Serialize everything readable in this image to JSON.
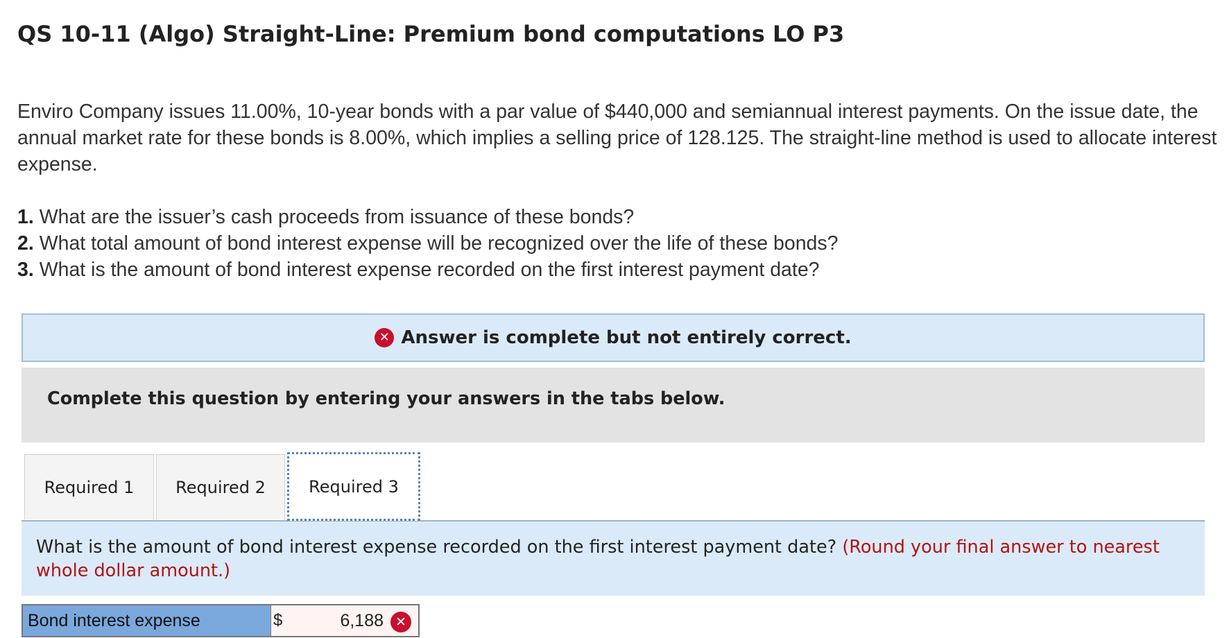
{
  "title": "QS 10-11 (Algo) Straight-Line: Premium bond computations LO P3",
  "problem_text": "Enviro Company issues 11.00%, 10-year bonds with a par value of $440,000 and semiannual interest payments. On the issue date, the annual market rate for these bonds is 8.00%, which implies a selling price of 128.125. The straight-line method is used to allocate interest expense.",
  "questions": [
    {
      "num": "1.",
      "text": "What are the issuer’s cash proceeds from issuance of these bonds?"
    },
    {
      "num": "2.",
      "text": "What total amount of bond interest expense will be recognized over the life of these bonds?"
    },
    {
      "num": "3.",
      "text": "What is the amount of bond interest expense recorded on the first interest payment date?"
    }
  ],
  "result": {
    "icon": "x-circle-icon",
    "icon_glyph": "✕",
    "text": "Answer is complete but not entirely correct."
  },
  "instruction": "Complete this question by entering your answers in the tabs below.",
  "tabs": [
    {
      "label": "Required 1",
      "active": false
    },
    {
      "label": "Required 2",
      "active": false
    },
    {
      "label": "Required 3",
      "active": true
    }
  ],
  "active_question": {
    "text": "What is the amount of bond interest expense recorded on the first interest payment date? ",
    "hint": "(Round your final answer to nearest whole dollar amount.)"
  },
  "answer": {
    "label": "Bond interest expense",
    "currency": "$",
    "value": "6,188",
    "status_icon": "x-circle-icon",
    "status_glyph": "✕",
    "correct": false
  },
  "colors": {
    "error_red": "#c8102e",
    "hint_red": "#b01313",
    "banner_blue": "#dbeaf8",
    "label_blue": "#7aa8dd",
    "panel_gray": "#e3e3e3"
  }
}
